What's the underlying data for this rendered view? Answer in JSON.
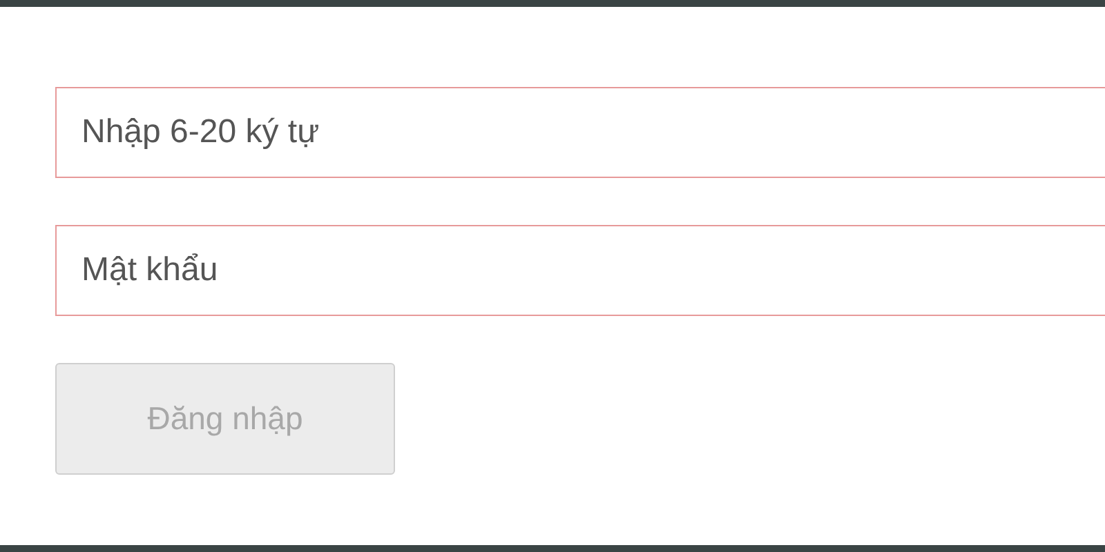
{
  "fields": [
    {
      "placeholder": "Nhập 6-20 ký tự",
      "error": true
    },
    {
      "placeholder": "Mật khẩu",
      "error": true
    }
  ],
  "button": {
    "label": "Đăng nhập",
    "disabled": true
  }
}
